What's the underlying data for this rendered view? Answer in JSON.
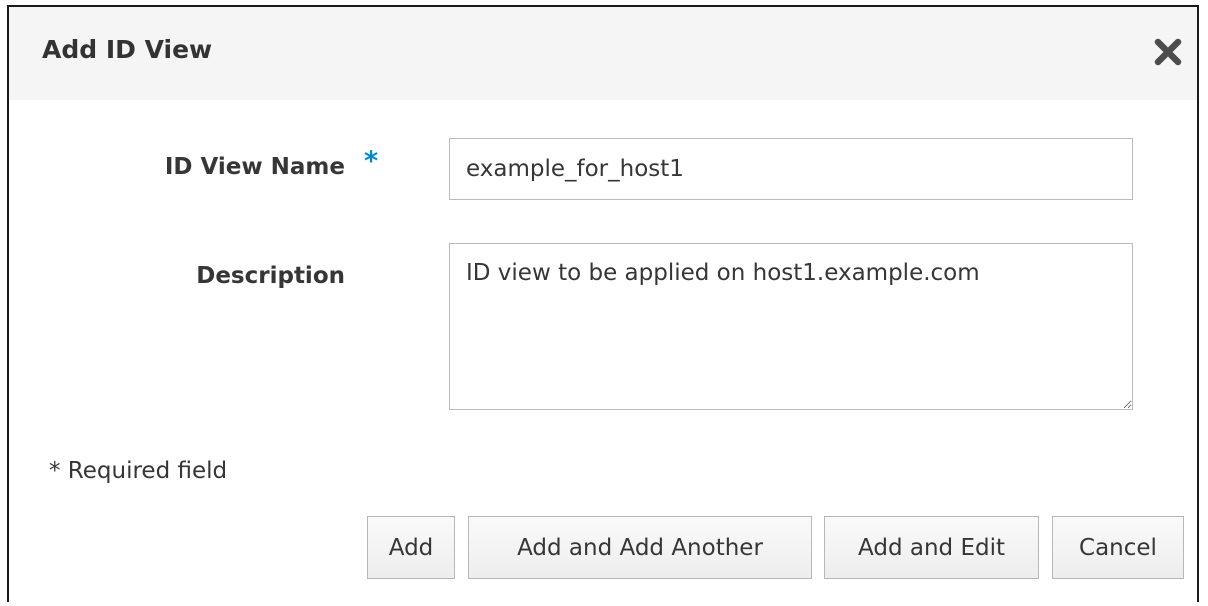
{
  "dialog": {
    "title": "Add ID View"
  },
  "form": {
    "name_label": "ID View Name",
    "required_marker": "*",
    "name_value": "example_for_host1",
    "description_label": "Description",
    "description_value": "ID view to be applied on host1.example.com",
    "required_note": "* Required field"
  },
  "buttons": {
    "add": "Add",
    "add_another": "Add and Add Another",
    "add_edit": "Add and Edit",
    "cancel": "Cancel"
  },
  "icons": {
    "close": "close-icon"
  },
  "colors": {
    "required_star": "#0088ce",
    "header_bg": "#f5f5f5",
    "text": "#363636"
  }
}
